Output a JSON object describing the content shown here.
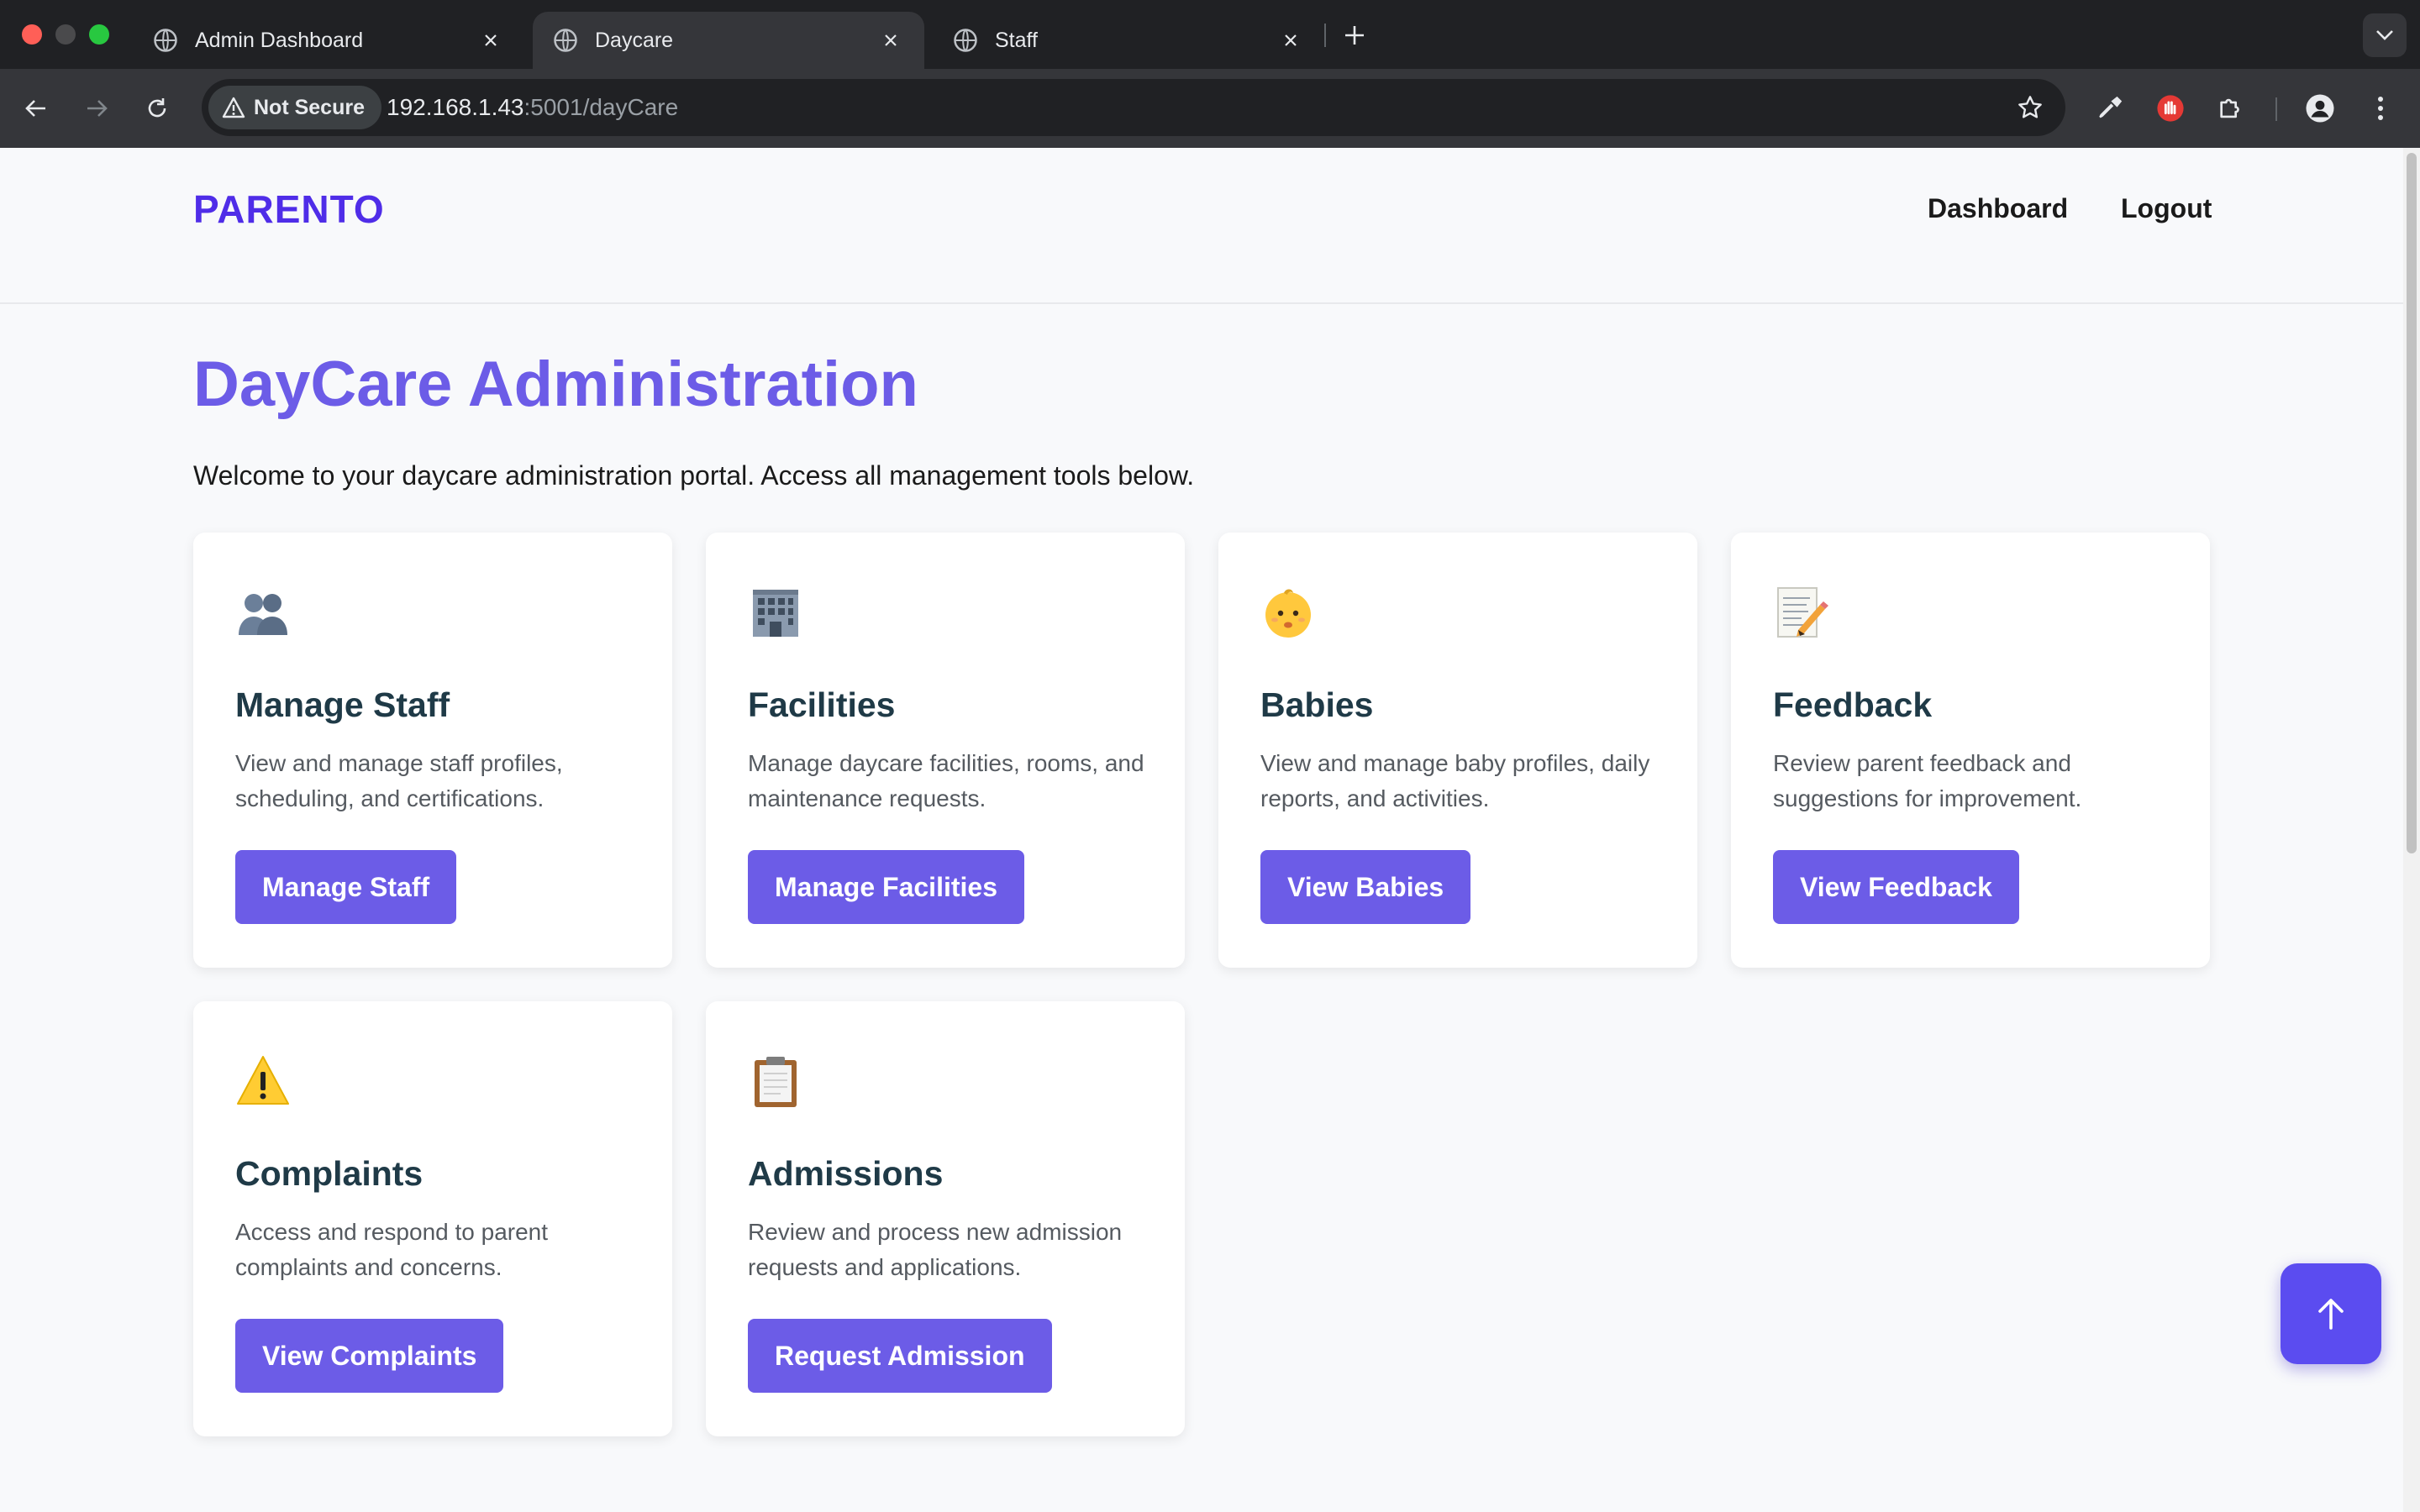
{
  "browser": {
    "tabs": [
      {
        "title": "Admin Dashboard",
        "active": false
      },
      {
        "title": "Daycare",
        "active": true
      },
      {
        "title": "Staff",
        "active": false
      }
    ],
    "security_label": "Not Secure",
    "url_host": "192.168.1.43",
    "url_path": ":5001/dayCare"
  },
  "header": {
    "brand": "PARENTO",
    "nav": [
      "Dashboard",
      "Logout"
    ]
  },
  "main": {
    "title": "DayCare Administration",
    "intro": "Welcome to your daycare administration portal. Access all management tools below."
  },
  "cards": [
    {
      "icon": "people-icon",
      "title": "Manage Staff",
      "description": "View and manage staff profiles, scheduling, and certifications.",
      "button": "Manage Staff"
    },
    {
      "icon": "office-building-icon",
      "title": "Facilities",
      "description": "Manage daycare facilities, rooms, and maintenance requests.",
      "button": "Manage Facilities"
    },
    {
      "icon": "baby-icon",
      "title": "Babies",
      "description": "View and manage baby profiles, daily reports, and activities.",
      "button": "View Babies"
    },
    {
      "icon": "memo-icon",
      "title": "Feedback",
      "description": "Review parent feedback and suggestions for improvement.",
      "button": "View Feedback"
    },
    {
      "icon": "warning-icon",
      "title": "Complaints",
      "description": "Access and respond to parent complaints and concerns.",
      "button": "View Complaints"
    },
    {
      "icon": "clipboard-icon",
      "title": "Admissions",
      "description": "Review and process new admission requests and applications.",
      "button": "Request Admission"
    }
  ],
  "colors": {
    "brand": "#4f2de8",
    "accent": "#6c5ce7",
    "card_title": "#1f3a47",
    "fab": "#5b4cf0"
  }
}
